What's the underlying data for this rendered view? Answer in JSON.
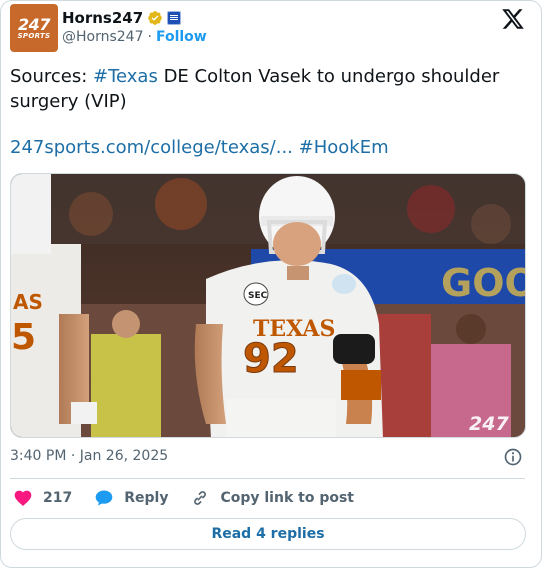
{
  "author": {
    "display_name": "Horns247",
    "handle": "@Horns247",
    "separator": "·",
    "follow_label": "Follow",
    "avatar_line1": "247",
    "avatar_line2": "SPORTS"
  },
  "tweet": {
    "text_prefix": "Sources: ",
    "text_hashtag": "#Texas",
    "text_rest": " DE Colton Vasek to undergo shoulder surgery (VIP)",
    "link_text": "247sports.com/college/texas/...",
    "link_space": " ",
    "link_hashtag": "#HookEm"
  },
  "media": {
    "jersey_text": "TEXAS",
    "jersey_number": "92",
    "left_player_text": "AS",
    "watermark": "247",
    "icon": "photo-image"
  },
  "meta": {
    "timestamp": "3:40 PM · Jan 26, 2025"
  },
  "actions": {
    "like_count": "217",
    "reply_label": "Reply",
    "copy_label": "Copy link to post"
  },
  "footer": {
    "read_replies_label": "Read 4 replies"
  },
  "colors": {
    "link": "#1d6ea6",
    "like": "#f91880",
    "reply": "#1d9bf0",
    "avatar_bg": "#c6692b",
    "burnt_orange": "#bf5700"
  },
  "icons": [
    "verified-badge-icon",
    "affiliate-badge-icon",
    "x-logo-icon",
    "info-icon",
    "heart-icon",
    "reply-bubble-icon",
    "link-icon"
  ]
}
